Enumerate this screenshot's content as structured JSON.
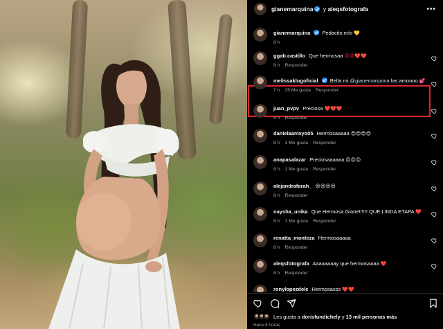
{
  "post": {
    "author": "gianemarquina",
    "connector": "y",
    "coauthor": "aleqsfotografa",
    "caption_author": "gianemarquina",
    "caption_text": "Pedacito mío",
    "caption_emoji": "💛",
    "caption_time": "8 h"
  },
  "comments": [
    {
      "user": "ggab.castillo",
      "text": "Que hermosaa",
      "emoji": "😍😍❤️❤️",
      "time": "8 h",
      "likes": "",
      "reply": "Responder"
    },
    {
      "user": "melissaklugoficial",
      "verified": true,
      "text_pre": "Bella mi",
      "mention": "@gianemarquina",
      "text_post": "las amoooo",
      "emoji": "💕",
      "time": "7 h",
      "likes": "25 Me gusta",
      "reply": "Responder"
    },
    {
      "user": "juan_pvpv",
      "text": "Preciosa",
      "emoji": "❤️❤️❤️",
      "time": "8 h",
      "likes": "",
      "reply": "Responder"
    },
    {
      "user": "danielaarroyo05",
      "text": "Hermosaaaaa",
      "emoji": "😍😍😍😍",
      "time": "8 h",
      "likes": "1 Me gusta",
      "reply": "Responder"
    },
    {
      "user": "anapasalazar",
      "text": "Preciosaaaaaa",
      "emoji": "😍😍😍",
      "time": "8 h",
      "likes": "1 Me gusta",
      "reply": "Responder"
    },
    {
      "user": "alejandrafarah_",
      "text": "",
      "emoji": "😍😍😍😍",
      "time": "8 h",
      "likes": "",
      "reply": "Responder"
    },
    {
      "user": "naysha_unika",
      "text": "Que Hermosa Giane!!!!!! QUE LINDA ETAPA",
      "emoji": "❤️",
      "time": "8 h",
      "likes": "1 Me gusta",
      "reply": "Responder"
    },
    {
      "user": "renatta_monteza",
      "text": "Hermosaaaaa",
      "emoji": "",
      "time": "8 h",
      "likes": "",
      "reply": "Responder"
    },
    {
      "user": "aleqsfotografa",
      "text": "Aaaaaaaay que hermosaaaa",
      "emoji": "❤️",
      "time": "8 h",
      "likes": "",
      "reply": "Responder"
    },
    {
      "user": "ronylopezdelc",
      "text": "Hermosasss",
      "emoji": "❤️❤️",
      "time": "",
      "likes": "",
      "reply": ""
    }
  ],
  "footer": {
    "likes_prefix": "Les gusta a",
    "likes_user": "dorisfundichely",
    "likes_mid": "y",
    "likes_count": "13 mil personas más",
    "time": "Hace 8 horas"
  },
  "colors": {
    "accent": "#3897f0",
    "highlight_border": "#e0262b",
    "heart": "#ed2a3b"
  }
}
